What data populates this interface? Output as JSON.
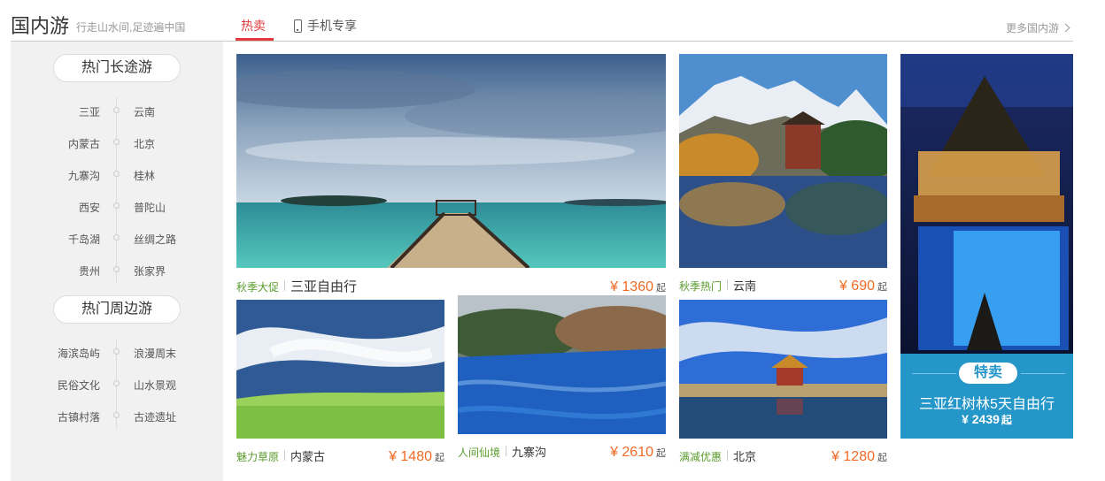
{
  "header": {
    "title": "国内游",
    "subtitle": "行走山水间,足迹遍中国",
    "tab_hot": "热卖",
    "tab_mobile": "手机专享",
    "more": "更多国内游"
  },
  "sidebar": {
    "long_title": "热门长途游",
    "long_left": [
      "三亚",
      "内蒙古",
      "九寨沟",
      "西安",
      "千岛湖",
      "贵州"
    ],
    "long_right": [
      "云南",
      "北京",
      "桂林",
      "普陀山",
      "丝绸之路",
      "张家界"
    ],
    "near_title": "热门周边游",
    "near_left": [
      "海滨岛屿",
      "民俗文化",
      "古镇村落"
    ],
    "near_right": [
      "浪漫周末",
      "山水景观",
      "古迹遗址"
    ]
  },
  "cards": [
    {
      "tag": "秋季大促",
      "place": "三亚自由行",
      "price": "¥ 1360",
      "suffix": "起",
      "image": "sanya-pier"
    },
    {
      "tag": "秋季热门",
      "place": "云南",
      "price": "¥ 690",
      "suffix": "起",
      "image": "yunnan-lake"
    },
    {
      "tag": "魅力草原",
      "place": "内蒙古",
      "price": "¥ 1480",
      "suffix": "起",
      "image": "grassland"
    },
    {
      "tag": "人间仙境",
      "place": "九寨沟",
      "price": "¥ 2610",
      "suffix": "起",
      "image": "jiuzhai-lake"
    },
    {
      "tag": "满减优惠",
      "place": "北京",
      "price": "¥ 1280",
      "suffix": "起",
      "image": "forbidden-city"
    }
  ],
  "promo": {
    "badge": "特卖",
    "title": "三亚红树林5天自由行",
    "price": "¥ 2439",
    "suffix": "起",
    "image": "resort-night"
  }
}
